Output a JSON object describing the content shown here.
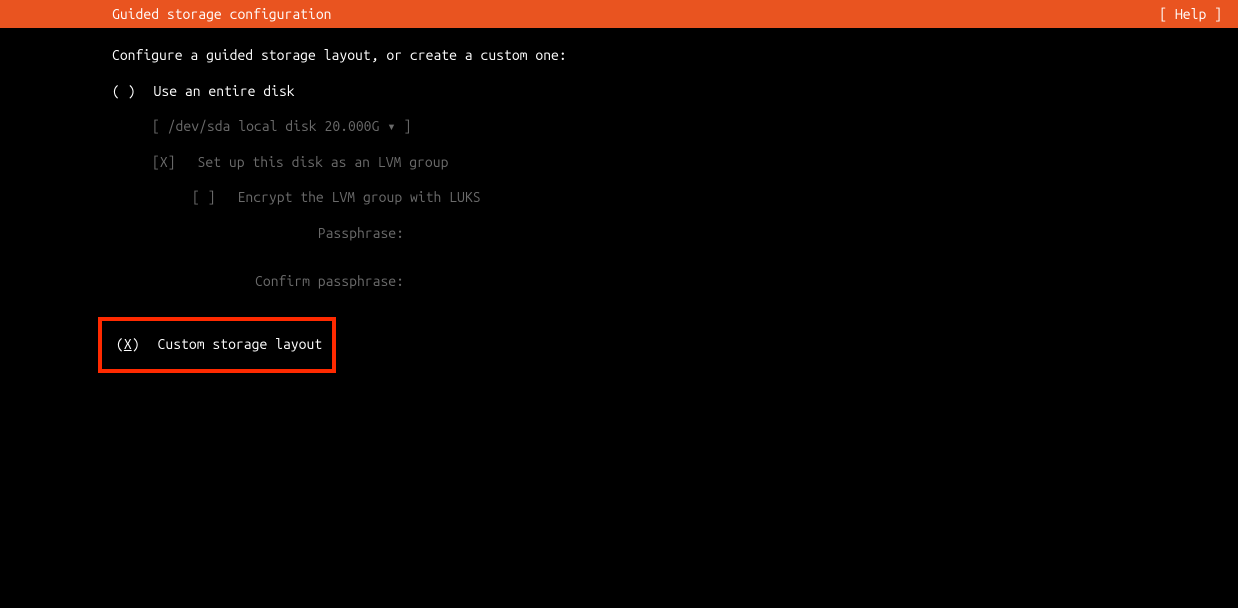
{
  "header": {
    "title": "Guided storage configuration",
    "help": "[ Help ]"
  },
  "intro": "Configure a guided storage layout, or create a custom one:",
  "option_entire": {
    "radio": "( )",
    "label": "Use an entire disk"
  },
  "disk_dropdown": "[ /dev/sda local disk 20.000G ▾ ]",
  "lvm": {
    "check": "[X]",
    "label": "Set up this disk as an LVM group"
  },
  "encrypt": {
    "check": "[ ]",
    "label": "Encrypt the LVM group with LUKS"
  },
  "passphrase_label": "Passphrase:",
  "confirm_label": "Confirm passphrase:",
  "option_custom": {
    "radio_open": "(",
    "radio_x": "X",
    "radio_close": ")",
    "label": "Custom storage layout"
  }
}
